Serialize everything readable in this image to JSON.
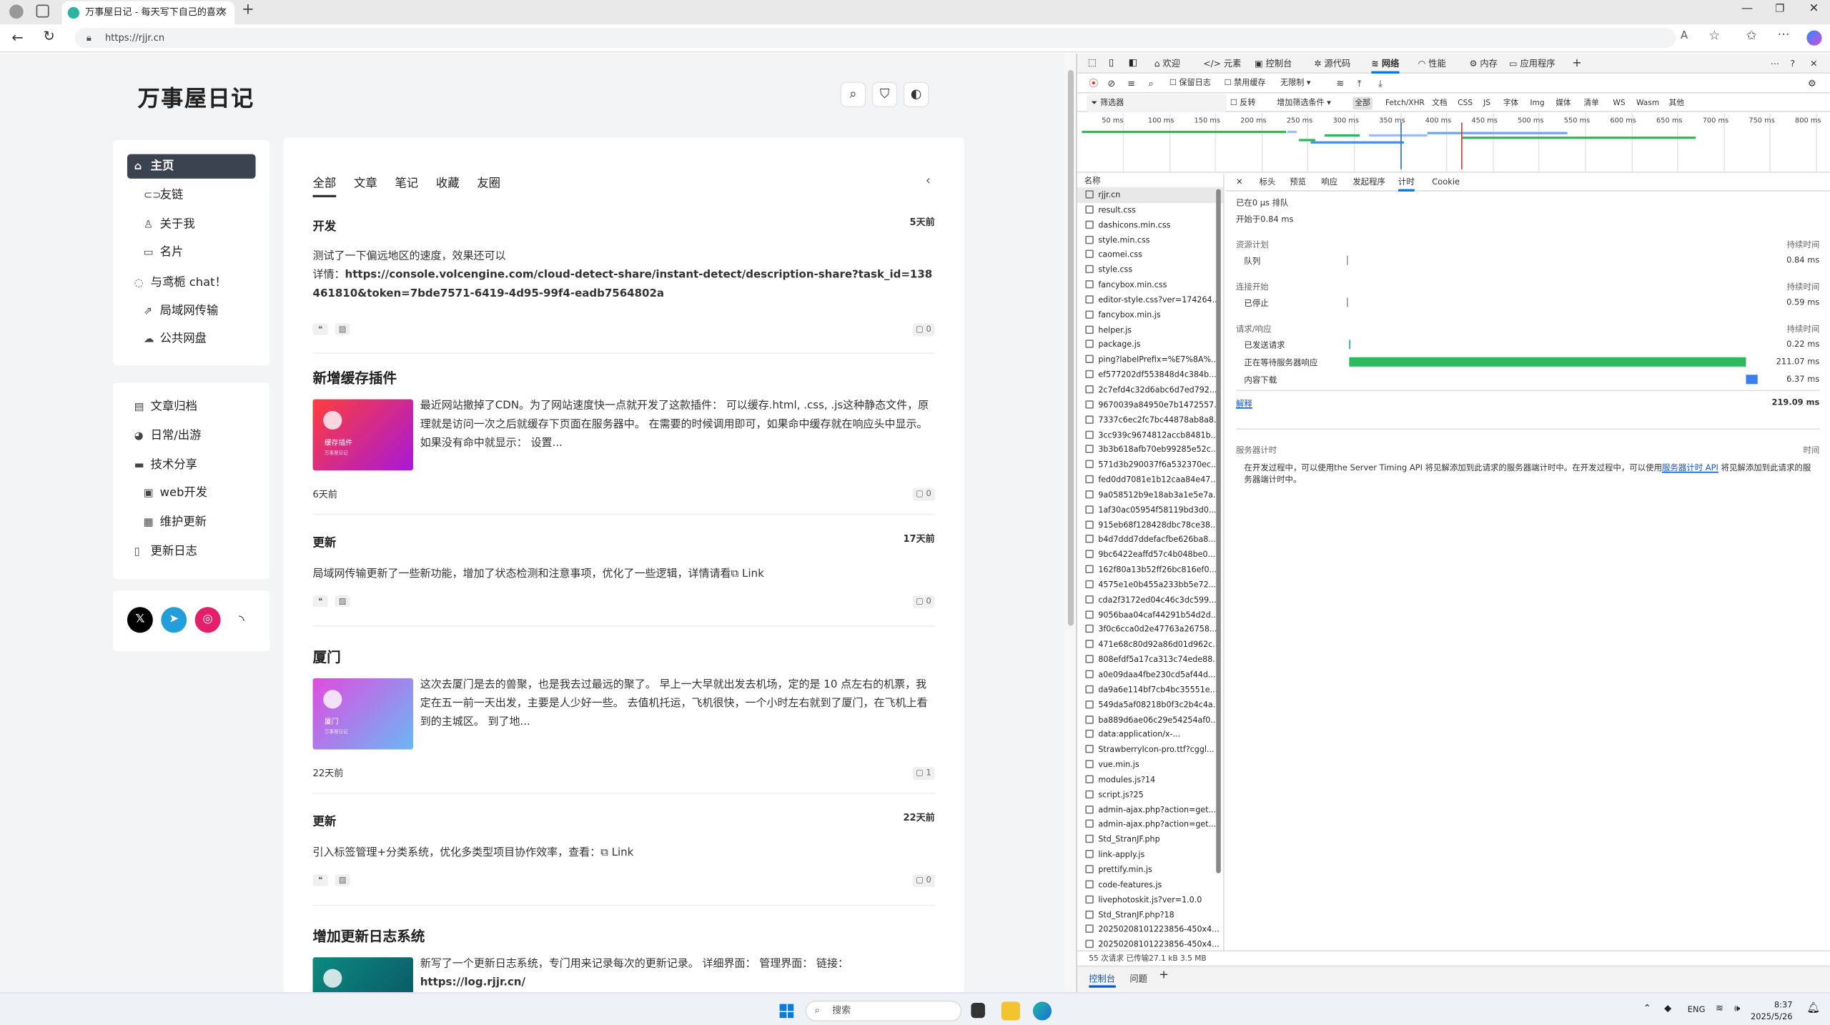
{
  "browser": {
    "tab_title": "万事屋日记 - 每天写下自己的喜欢",
    "url": "https://rjjr.cn"
  },
  "site": {
    "title": "万事屋日记",
    "nav_primary": [
      {
        "label": "主页",
        "icon": "home-icon"
      },
      {
        "label": "友链",
        "icon": "link-icon"
      },
      {
        "label": "关于我",
        "icon": "user-icon"
      },
      {
        "label": "名片",
        "icon": "card-icon"
      },
      {
        "label": "与鸢栀 chat！",
        "icon": "chat-icon"
      },
      {
        "label": "局域网传输",
        "icon": "share-icon"
      },
      {
        "label": "公共网盘",
        "icon": "cloud-icon"
      }
    ],
    "nav_secondary": [
      {
        "label": "文章归档",
        "icon": "archive-icon"
      },
      {
        "label": "日常/出游",
        "icon": "travel-icon"
      },
      {
        "label": "技术分享",
        "icon": "terminal-icon"
      },
      {
        "label": "web开发",
        "icon": "file-icon"
      },
      {
        "label": "维护更新",
        "icon": "monitor-icon"
      },
      {
        "label": "更新日志",
        "icon": "doc-icon"
      }
    ],
    "social": [
      "X",
      "telegram",
      "instagram",
      "rss"
    ],
    "filter_tabs": [
      "全部",
      "文章",
      "笔记",
      "收藏",
      "友圈"
    ],
    "posts": [
      {
        "category": "开发",
        "time": "5天前",
        "text": "测试了一下偏远地区的速度，效果还可以",
        "link_prefix": "详情：",
        "link": "https://console.volcengine.com/cloud-detect-share/instant-detect/description-share?task_id=138461810&token=7bde7571-6419-4d95-99f4-eadb7564802a",
        "comments": "0"
      },
      {
        "title": "新增缓存插件",
        "desc": "最近网站撤掉了CDN。为了网站速度快一点就开发了这款插件： 可以缓存.html, .css, .js这种静态文件，原理就是访问一次之后就缓存下页面在服务器中。 在需要的时候调用即可，如果命中缓存就在响应头中显示。 如果没有命中就显示： 设置...",
        "thumb_title": "缓存插件",
        "thumb_sub": "万事屋日记",
        "time": "6天前",
        "comments": "0"
      },
      {
        "category": "更新",
        "time": "17天前",
        "text": "局域网传输更新了一些新功能，增加了状态检测和注意事项，优化了一些逻辑，详情请看",
        "link": "Link",
        "comments": "0"
      },
      {
        "title": "厦门",
        "desc": "这次去厦门是去的兽聚，也是我去过最远的聚了。 早上一大早就出发去机场，定的是 10 点左右的机票，我定在五一前一天出发，主要是人少好一些。 去值机托运，飞机很快，一个小时左右就到了厦门，在飞机上看到的主城区。 到了地...",
        "thumb_title": "厦门",
        "thumb_sub": "万事屋日记",
        "time": "22天前",
        "comments": "1"
      },
      {
        "category": "更新",
        "time": "22天前",
        "text": "引入标签管理+分类系统，优化多类型项目协作效率，查看：",
        "link": "Link",
        "comments": "0"
      },
      {
        "title": "增加更新日志系统",
        "desc": "新写了一个更新日志系统，专门用来记录每次的更新记录。 详细界面： 管理界面： 链接：",
        "desc_link": "https://log.rjjr.cn/"
      }
    ]
  },
  "devtools": {
    "tabs": [
      "欢迎",
      "元素",
      "控制台",
      "源代码",
      "网络",
      "性能",
      "内存",
      "应用程序"
    ],
    "toolbar": {
      "preserve_log": "保留日志",
      "disable_cache": "禁用缓存",
      "throttle": "无限制"
    },
    "filter": {
      "placeholder": "筛选器",
      "invert": "反转",
      "more_filters": "增加筛选条件",
      "types": [
        "全部",
        "Fetch/XHR",
        "文档",
        "CSS",
        "JS",
        "字体",
        "Img",
        "媒体",
        "清单",
        "WS",
        "Wasm",
        "其他"
      ]
    },
    "timeline_ticks": [
      "50 ms",
      "100 ms",
      "150 ms",
      "200 ms",
      "250 ms",
      "300 ms",
      "350 ms",
      "400 ms",
      "450 ms",
      "500 ms",
      "550 ms",
      "600 ms",
      "650 ms",
      "700 ms",
      "750 ms",
      "800 ms"
    ],
    "name_header": "名称",
    "requests": [
      "rjjr.cn",
      "result.css",
      "dashicons.min.css",
      "style.min.css",
      "caomei.css",
      "style.css",
      "fancybox.min.css",
      "editor-style.css?ver=174264...",
      "fancybox.min.js",
      "helper.js",
      "package.js",
      "ping?labelPrefix=%E7%8A%...",
      "ef577202df553848d4c384b...",
      "2c7efd4c32d6abc6d7ed792...",
      "9670039a84950e7b1472557...",
      "7337c6ec2fc7bc44878ab8a8...",
      "3cc939c9674812accb8481b...",
      "3b3b618afb70eb99285e52c...",
      "571d3b290037f6a532370ec...",
      "fed0dd7081e1b12caa84e47...",
      "9a058512b9e18ab3a1e5e7a...",
      "1af30ac05954f58119bd3d0...",
      "915eb68f128428dbc78ce38...",
      "b4d7ddd7ddefacfbe626ba8...",
      "9bc6422eaffd57c4b048be0...",
      "162f80a13b52ff26bc816ef0...",
      "4575e1e0b455a233bb5e72...",
      "cda2f3172ed04c46c3dc599...",
      "9056baa04caf44291b54d2d...",
      "3f0c6cca0d2e47763a26758...",
      "471e68c80d92a86d01d962c...",
      "808efdf5a17ca313c74ede88...",
      "a0e09daa4fbe230cd5af44d...",
      "da9a6e114bf7cb4bc35551e...",
      "549da5af08218b0f3c2b4c4a...",
      "ba889d6ae06c29e54254af0...",
      "data:application/x-...",
      "StrawberryIcon-pro.ttf?cggl...",
      "vue.min.js",
      "modules.js?14",
      "script.js?25",
      "admin-ajax.php?action=get...",
      "admin-ajax.php?action=get...",
      "Std_StranJF.php",
      "link-apply.js",
      "prettify.min.js",
      "code-features.js",
      "livephotoskit.js?ver=1.0.0",
      "Std_StranJF.php?18",
      "20250208101223856-450x4...",
      "20250208101223856-450x4..."
    ],
    "detail_tabs": [
      "标头",
      "预览",
      "响应",
      "发起程序",
      "计时",
      "Cookie"
    ],
    "timing": {
      "queued_at": "已在0 μs 排队",
      "started_at": "开始于0.84 ms",
      "col_duration": "持续时间",
      "sec_resource": "资源计划",
      "queue_label": "队列",
      "queue_val": "0.84 ms",
      "sec_conn": "连接开始",
      "stalled_label": "已停止",
      "stalled_val": "0.59 ms",
      "sec_req": "请求/响应",
      "sent_label": "已发送请求",
      "sent_val": "0.22 ms",
      "wait_label": "正在等待服务器响应",
      "wait_val": "211.07 ms",
      "download_label": "内容下载",
      "download_val": "6.37 ms",
      "explain": "解释",
      "total": "219.09 ms",
      "server_title": "服务器计时",
      "server_time": "时间",
      "server_note_a": "在开发过程中，可以使用the Server Timing API 将见解添加到此请求的服务器端计时中。在开发过程中，可以使用",
      "server_note_link": "服务器计时 API",
      "server_note_b": " 将见解添加到此请求的服务器端计时中。"
    },
    "status": "55 次请求   已传输27.1 kB   3.5 MB",
    "drawer_tabs": [
      "控制台",
      "问题"
    ]
  },
  "taskbar": {
    "search": "搜索",
    "lang": "ENG",
    "time": "8:37",
    "date": "2025/5/26"
  }
}
